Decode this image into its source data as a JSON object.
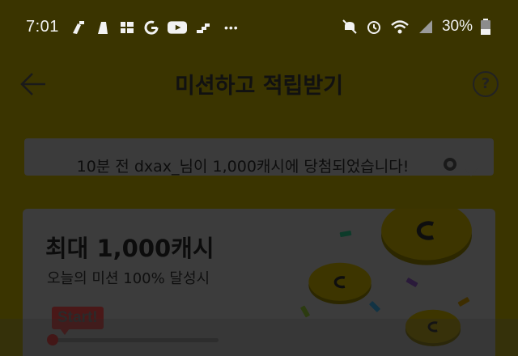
{
  "status_bar": {
    "time": "7:01",
    "battery": "30%",
    "more": "•••"
  },
  "app_bar": {
    "title": "미션하고 적립받기",
    "help_label": "?"
  },
  "notice": {
    "text": "10분 전 dxax_님이 1,000캐시에 당첨되었습니다!"
  },
  "mission_card": {
    "title": "최대 1,000캐시",
    "subtitle": "오늘의 미션 100% 달성시",
    "badge": "Start!",
    "progress": 0
  },
  "colors": {
    "background": "#3a3400",
    "card": "#3c3c3c",
    "accent_red": "#4a1818",
    "coin": "#3d3500"
  },
  "icons": [
    "back-arrow-icon",
    "help-icon",
    "coin-icon",
    "mute-icon",
    "alarm-icon",
    "wifi-icon",
    "signal-icon",
    "battery-icon"
  ]
}
